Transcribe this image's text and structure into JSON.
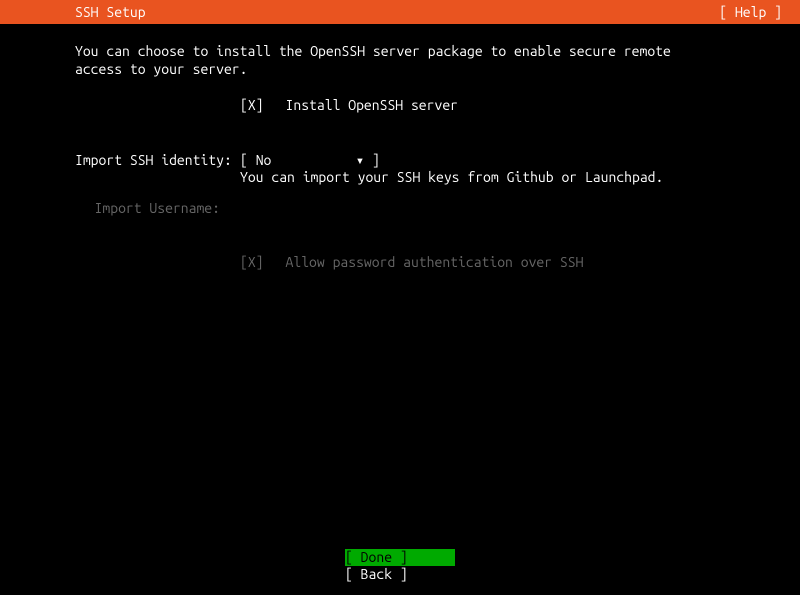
{
  "header": {
    "title": "SSH Setup",
    "help": "[ Help ]"
  },
  "description": "You can choose to install the OpenSSH server package to enable secure remote access to your server.",
  "install_openssh": {
    "checkbox": "[X]",
    "label": "Install OpenSSH server"
  },
  "import_identity": {
    "label": "Import SSH identity:",
    "bracket_l": "[ ",
    "value": "No",
    "arrow": "▾",
    "bracket_r": " ]",
    "help": "You can import your SSH keys from Github or Launchpad."
  },
  "import_username": {
    "label": "Import Username:"
  },
  "allow_password": {
    "checkbox": "[X]",
    "label": "Allow password authentication over SSH"
  },
  "footer": {
    "done": "[ Done       ]",
    "back": "[ Back       ]"
  }
}
